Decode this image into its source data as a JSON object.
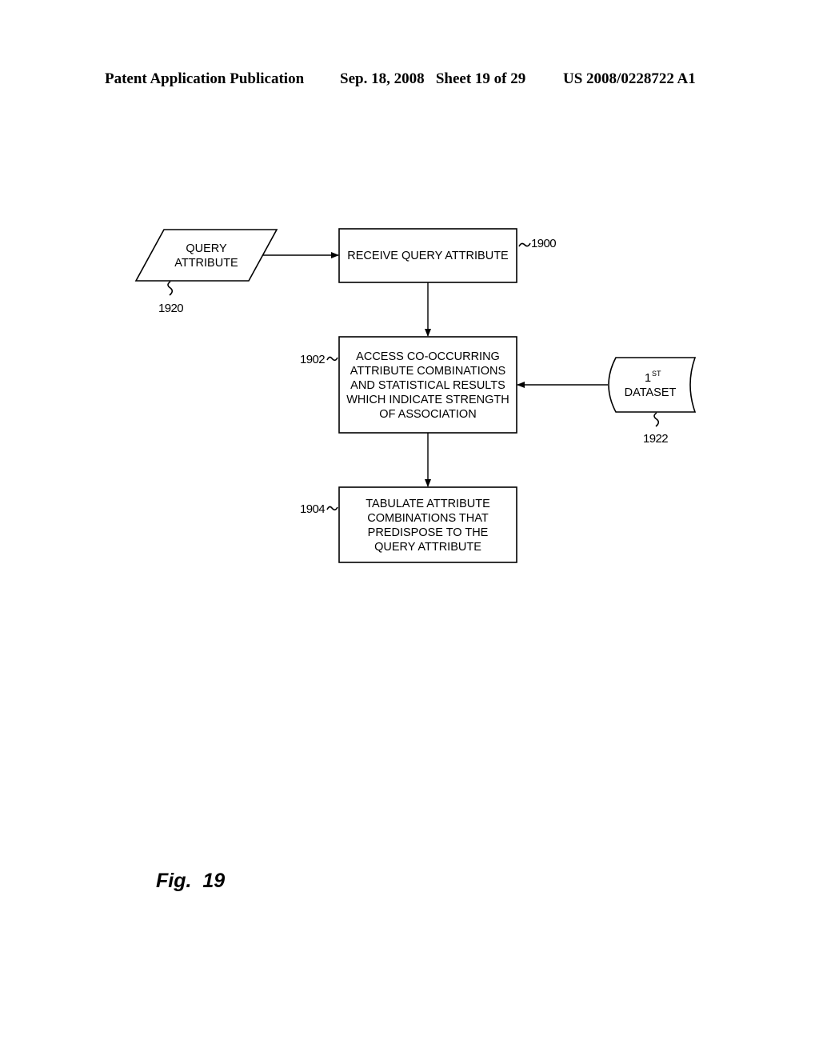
{
  "header": {
    "publication": "Patent Application Publication",
    "date_sheet": "Sep. 18, 2008   Sheet 19 of 29",
    "number": "US 2008/0228722 A1"
  },
  "diagram": {
    "nodes": {
      "query_attribute_input": {
        "shape": "parallelogram",
        "lines": [
          "QUERY",
          "ATTRIBUTE"
        ],
        "ref": "1920"
      },
      "receive_query_attribute": {
        "shape": "rectangle",
        "lines": [
          "RECEIVE QUERY ATTRIBUTE"
        ],
        "ref": "1900"
      },
      "access_combinations": {
        "shape": "rectangle",
        "lines": [
          "ACCESS CO-OCCURRING",
          "ATTRIBUTE COMBINATIONS",
          "AND STATISTICAL RESULTS",
          "WHICH INDICATE STRENGTH",
          "OF ASSOCIATION"
        ],
        "ref": "1902"
      },
      "first_dataset": {
        "shape": "stored-data",
        "line1_base": "1",
        "line1_sup": "ST",
        "line2": "DATASET",
        "ref": "1922"
      },
      "tabulate": {
        "shape": "rectangle",
        "lines": [
          "TABULATE ATTRIBUTE",
          "COMBINATIONS THAT",
          "PREDISPOSE TO THE",
          "QUERY ATTRIBUTE"
        ],
        "ref": "1904"
      }
    },
    "edges": [
      {
        "from": "query_attribute_input",
        "to": "receive_query_attribute"
      },
      {
        "from": "receive_query_attribute",
        "to": "access_combinations"
      },
      {
        "from": "first_dataset",
        "to": "access_combinations"
      },
      {
        "from": "access_combinations",
        "to": "tabulate"
      }
    ]
  },
  "figure_label": "Fig.  19"
}
